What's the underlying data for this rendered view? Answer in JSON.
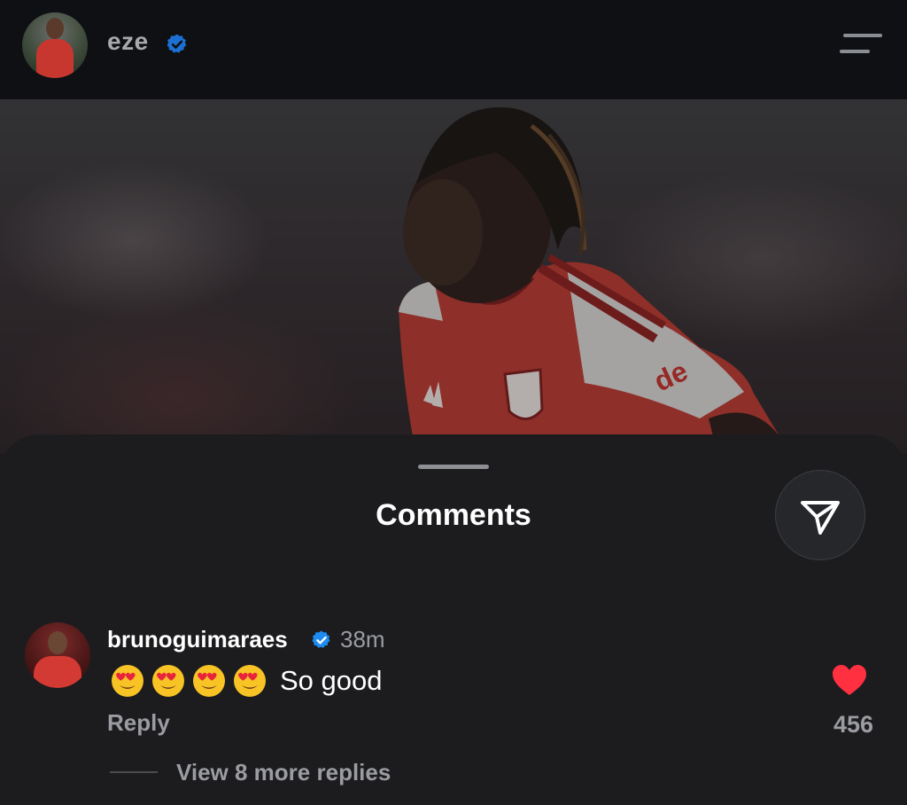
{
  "header": {
    "username": "eze",
    "verified": true
  },
  "sheet": {
    "title": "Comments"
  },
  "comment": {
    "username": "brunoguimaraes",
    "verified": true,
    "time": "38m",
    "emoji_count": 4,
    "emoji": "heart-eyes",
    "text": "So good",
    "reply_label": "Reply",
    "likes": "456",
    "liked": true,
    "view_replies": "View 8 more replies"
  },
  "colors": {
    "verified": "#1d8cf0",
    "like_heart": "#ff3040",
    "sheet_bg": "#1c1c1e",
    "header_bg": "#0e1014"
  }
}
